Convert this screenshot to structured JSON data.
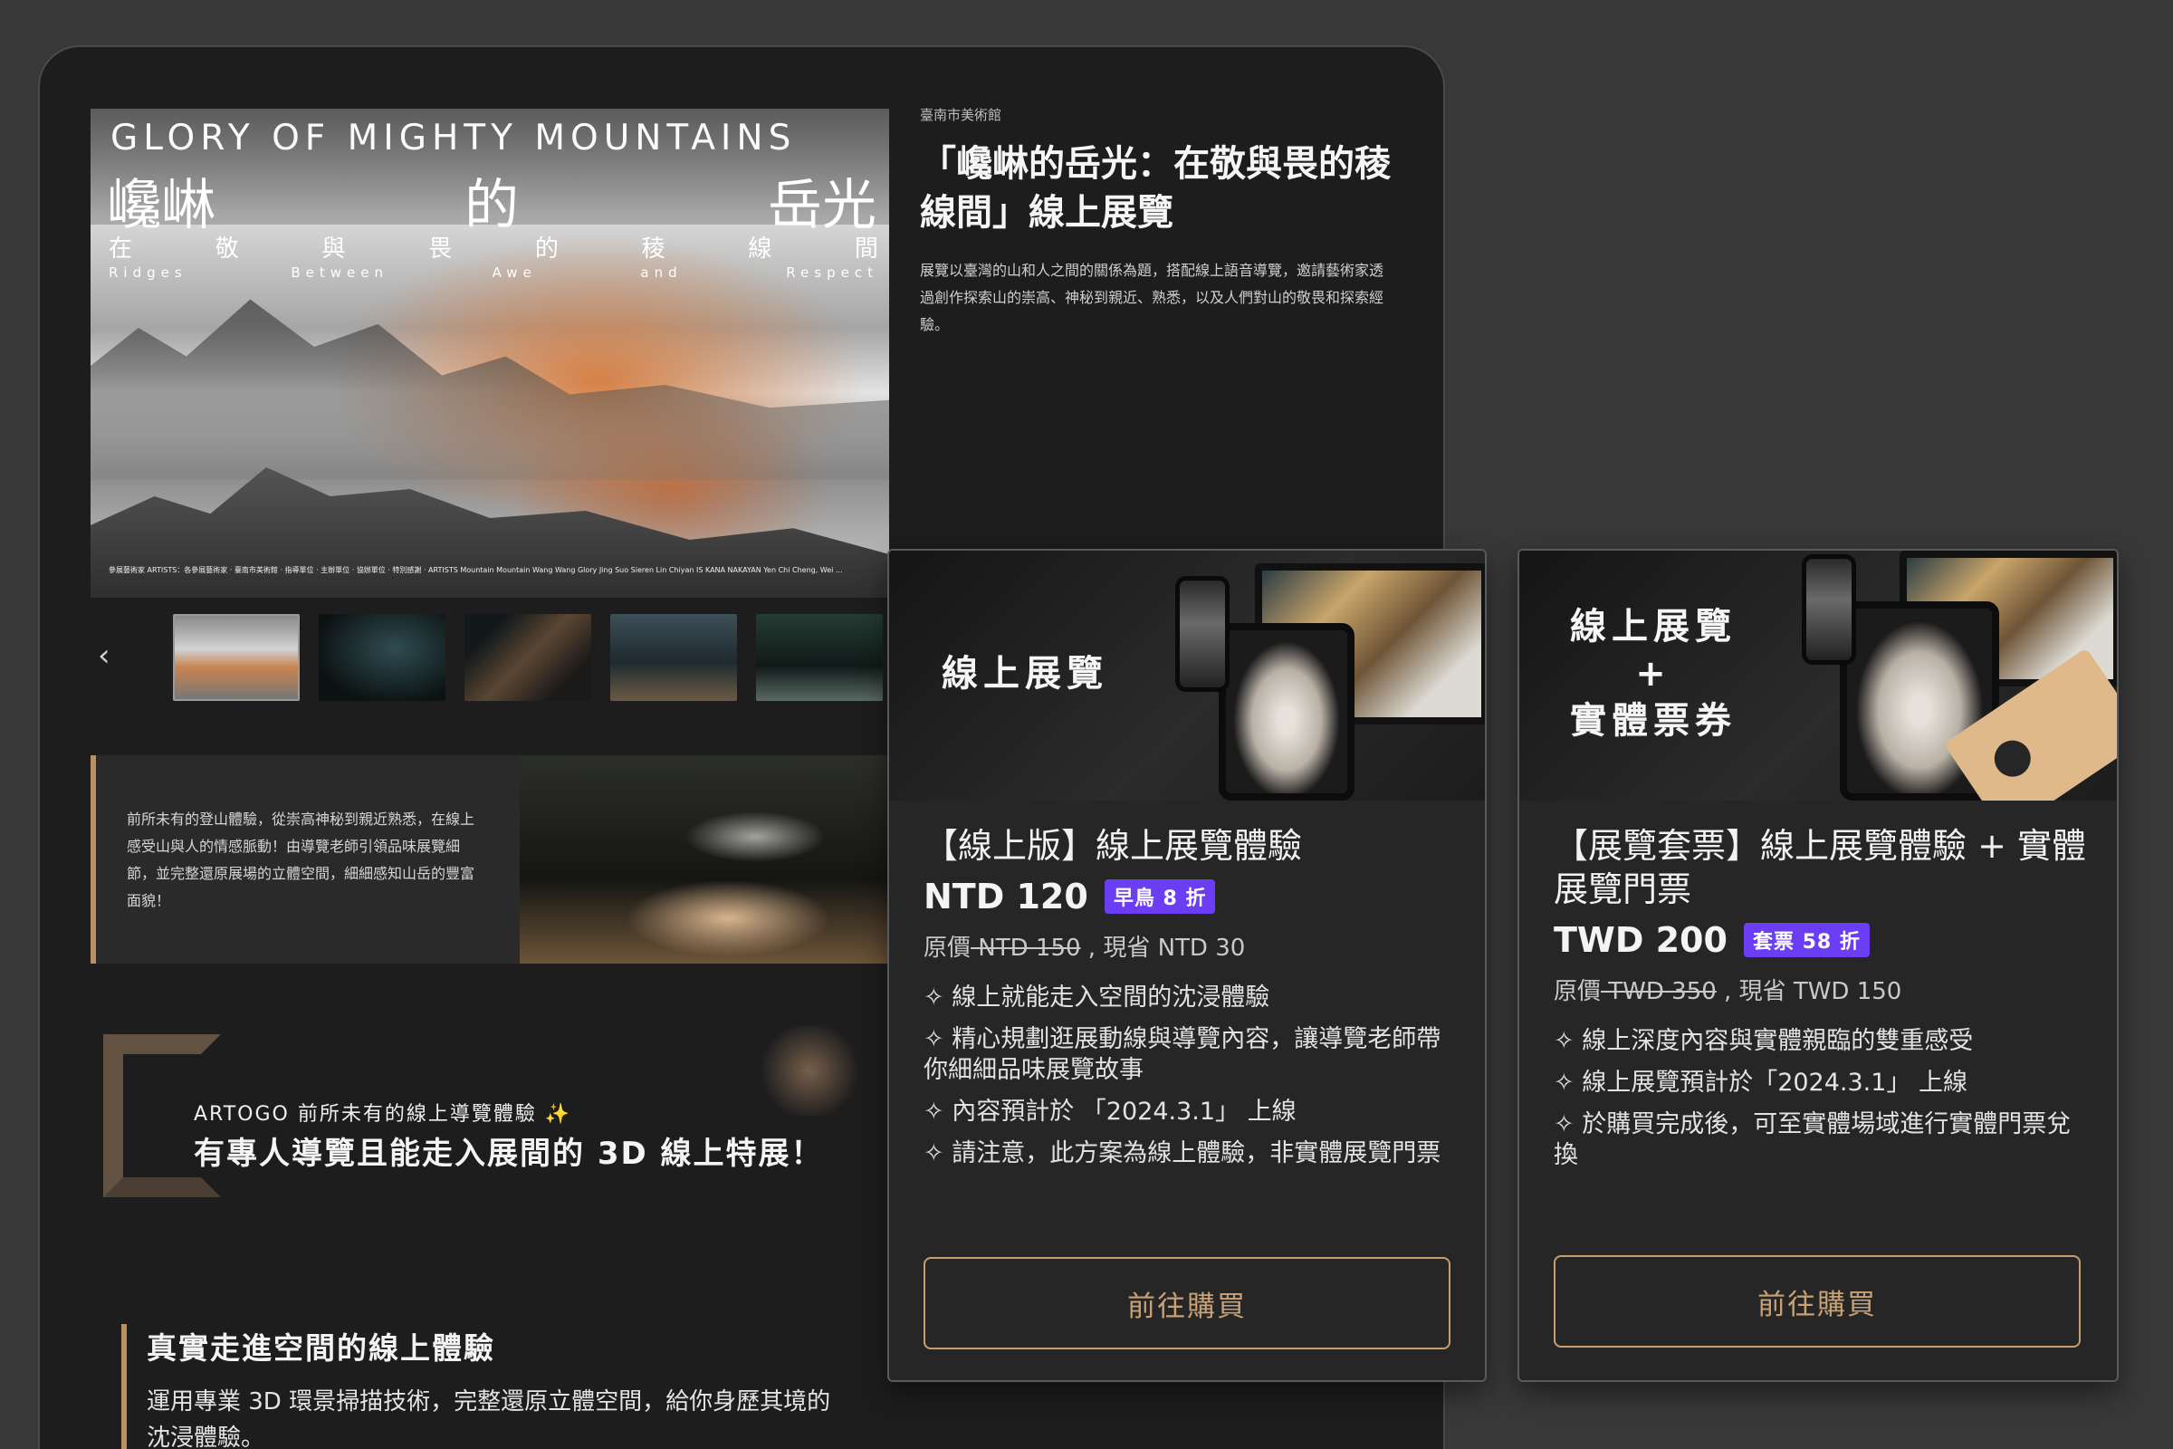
{
  "hero": {
    "title_en": "GLORY OF MIGHTY MOUNTAINS",
    "title_zh_chars": [
      "巉崊",
      "的",
      "岳光"
    ],
    "subtitle_zh_chars": [
      "在",
      "敬",
      "與",
      "畏",
      "的",
      "稜",
      "線",
      "間"
    ],
    "subtitle_en_words": [
      "Ridges",
      "Between",
      "Awe",
      "and",
      "Respect"
    ],
    "credits": "參展藝術家 ARTISTS：各參展藝術家 · 臺南市美術館 · 指導單位 · 主辦單位 · 協辦單位 · 特別感謝 · ARTISTS Mountain Mountain Wang Wang Glory Jing Suo Sieren Lin Chiyan IS KANA NAKAYAN Yen Chi Cheng, Wei ..."
  },
  "gallery": {
    "prev_label": "‹",
    "next_label": "›"
  },
  "description": {
    "text": "前所未有的登山體驗，從崇高神秘到親近熟悉，在線上感受山與人的情感脈動！由導覽老師引領品味展覽細節，並完整還原展場的立體空間，細細感知山岳的豐富面貌！"
  },
  "promo": {
    "line1": "ARTOGO 前所未有的線上導覽體驗 ✨",
    "line2": "有專人導覽且能走入展間的 3D 線上特展！"
  },
  "feature": {
    "title": "真實走進空間的線上體驗",
    "desc": "運用專業 3D 環景掃描技術，完整還原立體空間，給你身歷其境的沈浸體驗。"
  },
  "info": {
    "org": "臺南市美術館",
    "title": "「巉崊的岳光：在敬與畏的稜線間」線上展覽",
    "intro": "展覽以臺灣的山和人之間的關係為題，搭配線上語音導覽，邀請藝術家透過創作探索山的崇高、神秘到親近、熟悉，以及人們對山的敬畏和探索經驗。"
  },
  "cards": [
    {
      "image_label": "線上展覽",
      "title": "【線上版】線上展覽體驗",
      "price": "NTD 120",
      "badge": "早鳥 8 折",
      "orig_prefix": "原價",
      "orig_strike": " NTD 150",
      "orig_suffix": " , 現省 NTD 30",
      "features": [
        "✧ 線上就能走入空間的沈浸體驗",
        "✧ 精心規劃逛展動線與導覽內容，讓導覽老師帶你細細品味展覽故事",
        "✧ 內容預計於 「2024.3.1」 上線",
        "✧ 請注意，此方案為線上體驗，非實體展覽門票"
      ],
      "button": "前往購買"
    },
    {
      "image_label_lines": [
        "線上展覽",
        "+",
        "實體票券"
      ],
      "title": "【展覽套票】線上展覽體驗 + 實體展覽門票",
      "price": "TWD 200",
      "badge": "套票 58 折",
      "orig_prefix": "原價",
      "orig_strike": " TWD 350",
      "orig_suffix": " , 現省 TWD 150",
      "features": [
        "✧ 線上深度內容與實體親臨的雙重感受",
        "✧ 線上展覽預計於「2024.3.1」 上線",
        "✧ 於購買完成後，可至實體場域進行實體門票兌換"
      ],
      "button": "前往購買"
    }
  ]
}
